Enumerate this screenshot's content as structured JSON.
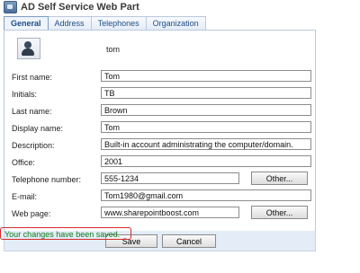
{
  "window": {
    "title": "AD Self Service Web Part",
    "icon": "app-icon"
  },
  "tabs": [
    {
      "label": "General",
      "active": true
    },
    {
      "label": "Address",
      "active": false
    },
    {
      "label": "Telephones",
      "active": false
    },
    {
      "label": "Organization",
      "active": false
    }
  ],
  "user": {
    "avatar_icon": "user-avatar-icon",
    "username": "tom"
  },
  "fields": {
    "first_name": {
      "label": "First name:",
      "value": "Tom"
    },
    "initials": {
      "label": "Initials:",
      "value": "TB"
    },
    "last_name": {
      "label": "Last name:",
      "value": "Brown"
    },
    "display_name": {
      "label": "Display name:",
      "value": "Tom"
    },
    "description": {
      "label": "Description:",
      "value": "Built-in account administrating the computer/domain."
    },
    "office": {
      "label": "Office:",
      "value": "2001"
    },
    "telephone": {
      "label": "Telephone number:",
      "value": "555-1234",
      "other_label": "Other..."
    },
    "email": {
      "label": "E-mail:",
      "value": "Tom1980@gmail.com"
    },
    "web_page": {
      "label": "Web page:",
      "value": "www.sharepointboost.com",
      "other_label": "Other..."
    }
  },
  "actions": {
    "save_label": "Save",
    "cancel_label": "Cancel"
  },
  "status": {
    "message": "Your changes have been saved.",
    "text_color": "#0a7a1a",
    "border_color": "#d42b2b"
  }
}
